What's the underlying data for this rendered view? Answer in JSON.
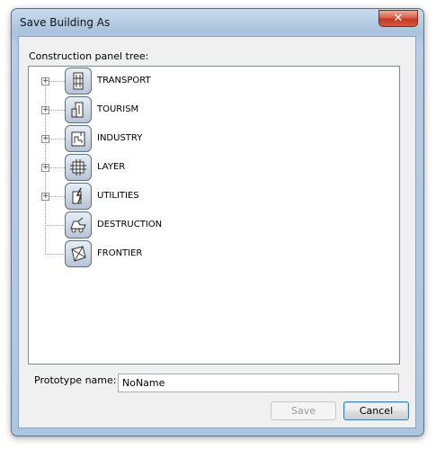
{
  "window": {
    "title": "Save Building As",
    "close_glyph": "✕"
  },
  "tree": {
    "label": "Construction panel tree:",
    "nodes": [
      {
        "label": "TRANSPORT",
        "expandable": true,
        "icon": "transport-icon"
      },
      {
        "label": "TOURISM",
        "expandable": true,
        "icon": "tourism-icon"
      },
      {
        "label": "INDUSTRY",
        "expandable": true,
        "icon": "industry-icon"
      },
      {
        "label": "LAYER",
        "expandable": true,
        "icon": "layer-icon"
      },
      {
        "label": "UTILITIES",
        "expandable": true,
        "icon": "utilities-icon"
      },
      {
        "label": "DESTRUCTION",
        "expandable": false,
        "icon": "destruction-icon"
      },
      {
        "label": "FRONTIER",
        "expandable": false,
        "icon": "frontier-icon"
      }
    ],
    "expander_glyph": "+"
  },
  "prototype": {
    "label": "Prototype name:",
    "value": "NoName"
  },
  "buttons": {
    "save": "Save",
    "cancel": "Cancel"
  }
}
